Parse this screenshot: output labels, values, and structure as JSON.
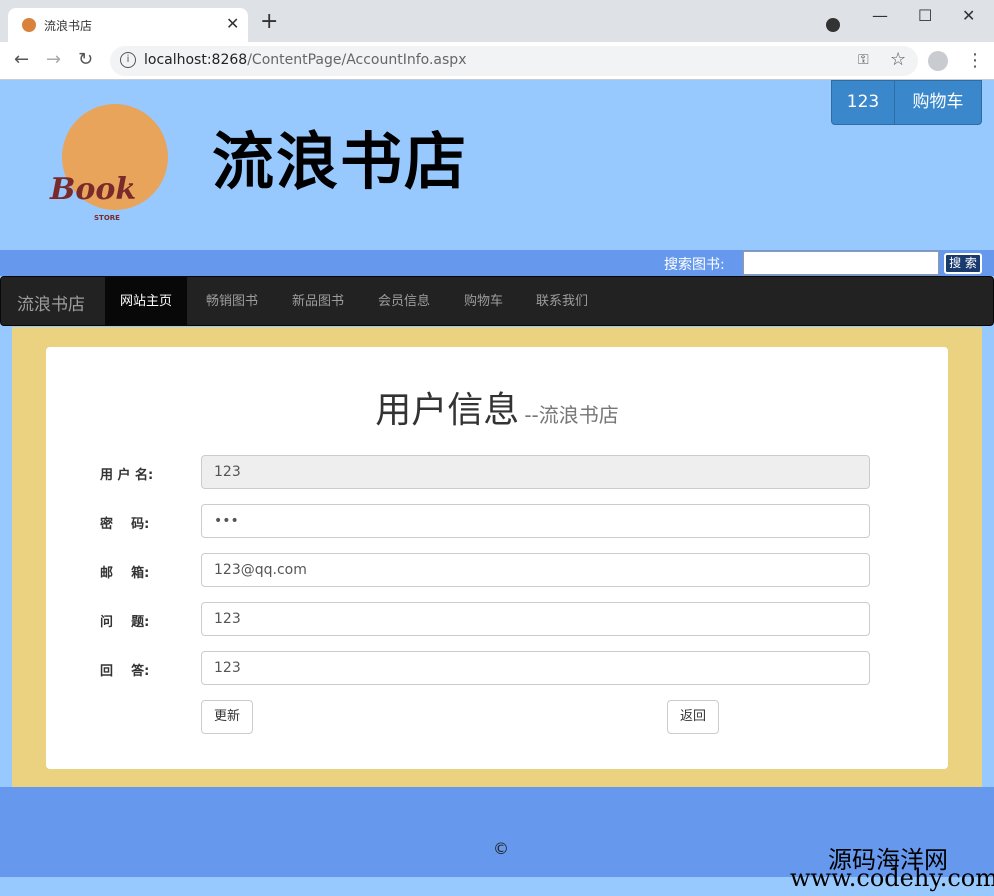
{
  "browser": {
    "tab_title": "流浪书店",
    "url_host": "localhost:8268",
    "url_path": "/ContentPage/AccountInfo.aspx"
  },
  "header": {
    "logo_text": "Book",
    "logo_subtext": "STORE",
    "site_title": "流浪书店",
    "cart_count": "123",
    "cart_label": "购物车"
  },
  "search": {
    "label": "搜索图书:",
    "placeholder": "",
    "button_label": "搜 索"
  },
  "navbar": {
    "brand": "流浪书店",
    "items": [
      {
        "label": "网站主页",
        "active": true
      },
      {
        "label": "畅销图书",
        "active": false
      },
      {
        "label": "新品图书",
        "active": false
      },
      {
        "label": "会员信息",
        "active": false
      },
      {
        "label": "购物车",
        "active": false
      },
      {
        "label": "联系我们",
        "active": false
      }
    ]
  },
  "form": {
    "title": "用户信息",
    "subtitle": "--流浪书店",
    "fields": [
      {
        "label": "用 户 名:",
        "value": "123",
        "readonly": true
      },
      {
        "label": "密    码:",
        "value": "•••",
        "readonly": false
      },
      {
        "label": "邮    箱:",
        "value": "123@qq.com",
        "readonly": false
      },
      {
        "label": "问    题:",
        "value": "123",
        "readonly": false
      },
      {
        "label": "回    答:",
        "value": "123",
        "readonly": false
      }
    ],
    "update_button": "更新",
    "back_button": "返回"
  },
  "footer": {
    "copyright": "©",
    "watermark_site": "源码海洋网",
    "watermark_url": "www.codehy.com"
  }
}
